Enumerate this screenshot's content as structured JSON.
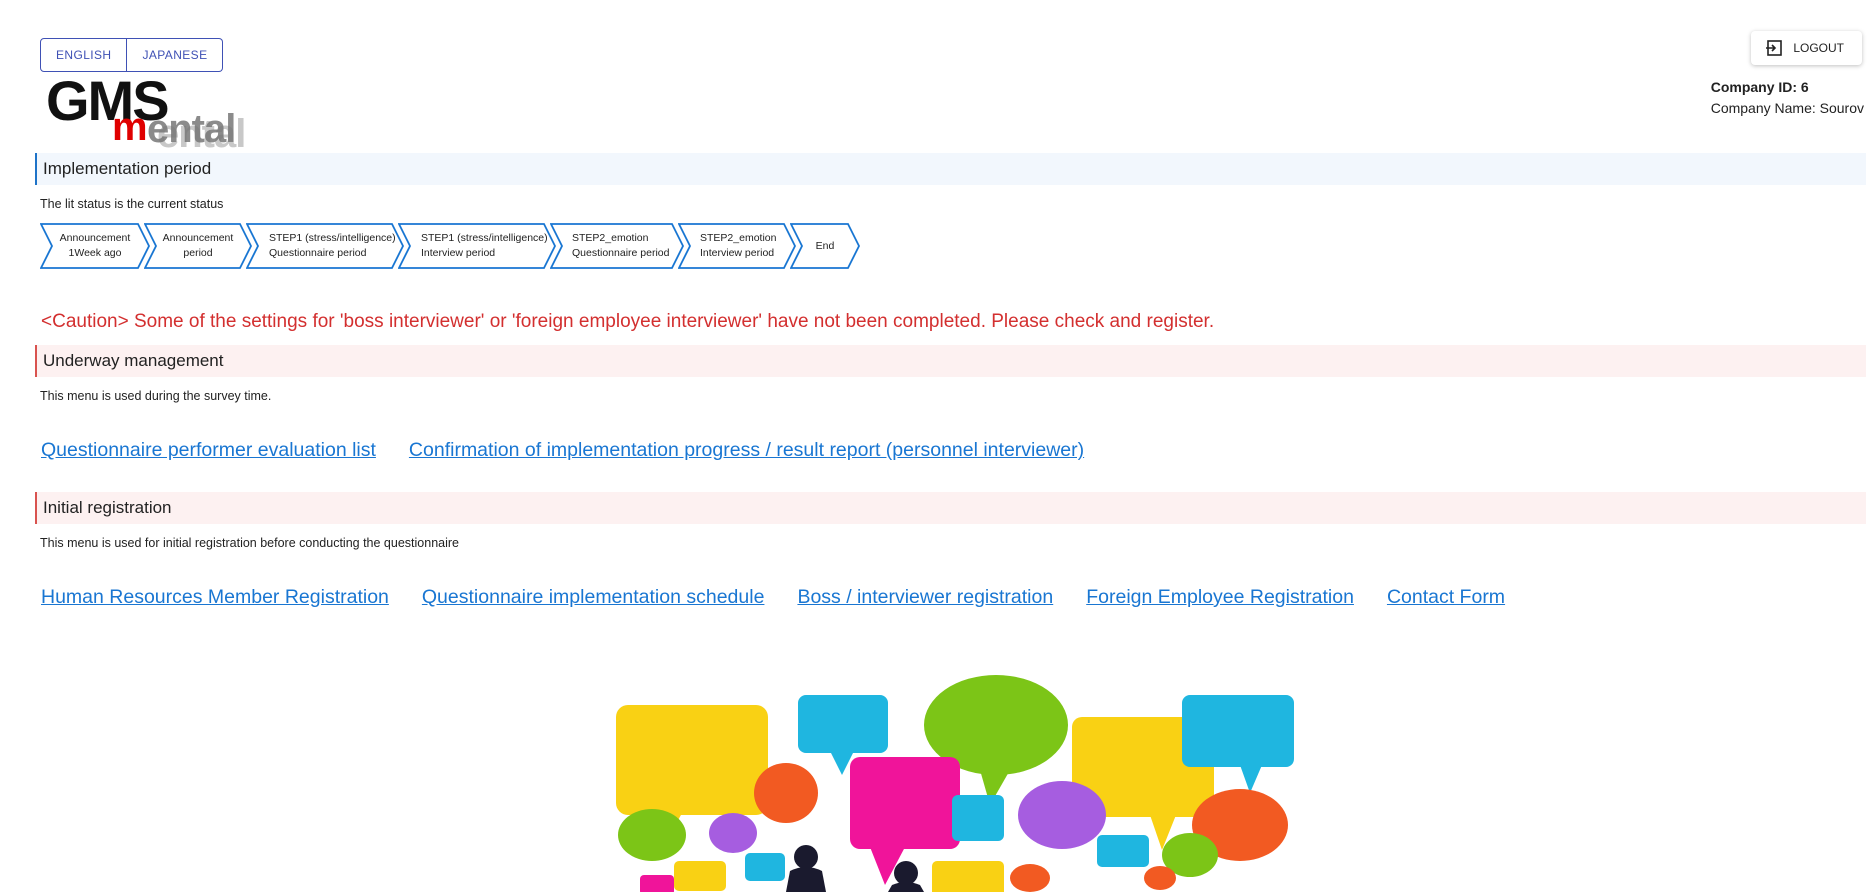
{
  "language": {
    "english_label": "ENGLISH",
    "japanese_label": "JAPANESE"
  },
  "header": {
    "logout_label": "LOGOUT",
    "logo_text": "GMSmental"
  },
  "company": {
    "id_line": "Company ID: 6",
    "name_line": "Company Name: Sourov"
  },
  "implementation": {
    "title": "Implementation period",
    "note": "The lit status is the current status",
    "steps": [
      {
        "line1": "Announcement",
        "line2": "1Week ago"
      },
      {
        "line1": "Announcement",
        "line2": "period"
      },
      {
        "line1": "STEP1 (stress/intelligence)",
        "line2": "Questionnaire period"
      },
      {
        "line1": "STEP1 (stress/intelligence)",
        "line2": "Interview period"
      },
      {
        "line1": "STEP2_emotion",
        "line2": "Questionnaire period"
      },
      {
        "line1": "STEP2_emotion",
        "line2": "Interview period"
      },
      {
        "line1": "End",
        "line2": ""
      }
    ],
    "step_color": "#1976d2"
  },
  "caution": "<Caution> Some of the settings for 'boss interviewer' or 'foreign employee interviewer' have not been completed. Please check and register.",
  "underway": {
    "title": "Underway management",
    "note": "This menu is used during the survey time.",
    "links": [
      "Questionnaire performer evaluation list",
      "Confirmation of implementation progress / result report (personnel interviewer)"
    ]
  },
  "initial": {
    "title": "Initial registration",
    "note": "This menu is used for initial registration before conducting the questionnaire",
    "links": [
      "Human Resources Member Registration",
      "Questionnaire implementation schedule",
      "Boss / interviewer registration",
      "Foreign Employee Registration",
      "Contact Form"
    ]
  },
  "colors": {
    "accent_blue": "#1976d2",
    "caution_red": "#d32f2f",
    "brand_red": "#e00000"
  }
}
